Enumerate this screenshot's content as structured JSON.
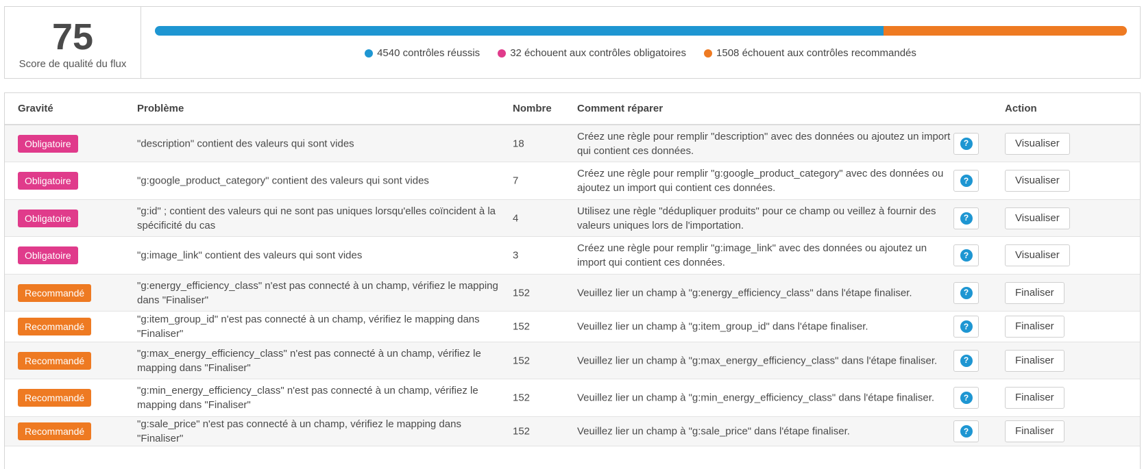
{
  "score": {
    "value": "75",
    "label": "Score de qualité du flux",
    "passed": 4540,
    "failed_mandatory": 32,
    "failed_recommended": 1508,
    "legend": [
      {
        "text": "4540 contrôles réussis",
        "color": "#1e96d2"
      },
      {
        "text": "32 échouent aux contrôles obligatoires",
        "color": "#e03b8b"
      },
      {
        "text": "1508 échouent aux contrôles recommandés",
        "color": "#ee7a22"
      }
    ],
    "bar": [
      {
        "fraction": 0.7499,
        "color": "#1e96d2"
      },
      {
        "fraction": 0.2501,
        "color": "#ee7a22"
      }
    ]
  },
  "table": {
    "headers": {
      "severity": "Gravité",
      "problem": "Problème",
      "count": "Nombre",
      "fix": "Comment réparer",
      "action": "Action"
    },
    "rows": [
      {
        "severity": "Obligatoire",
        "type": "mand",
        "problem": "\"description\" contient des valeurs qui sont vides",
        "count": "18",
        "fix": "Créez une règle pour remplir \"description\" avec des données ou ajoutez un import qui contient ces données.",
        "action": "Visualiser"
      },
      {
        "severity": "Obligatoire",
        "type": "mand",
        "problem": "\"g:google_product_category\" contient des valeurs qui sont vides",
        "count": "7",
        "fix": "Créez une règle pour remplir \"g:google_product_category\" avec des données ou ajoutez un import qui contient ces données.",
        "action": "Visualiser"
      },
      {
        "severity": "Obligatoire",
        "type": "mand",
        "problem": "\"g:id\" ; contient des valeurs qui ne sont pas uniques lorsqu'elles coïncident à la spécificité du cas",
        "count": "4",
        "fix": "Utilisez une règle \"dédupliquer produits\" pour ce champ ou veillez à fournir des valeurs uniques lors de l'importation.",
        "action": "Visualiser"
      },
      {
        "severity": "Obligatoire",
        "type": "mand",
        "problem": "\"g:image_link\" contient des valeurs qui sont vides",
        "count": "3",
        "fix": "Créez une règle pour remplir \"g:image_link\" avec des données ou ajoutez un import qui contient ces données.",
        "action": "Visualiser"
      },
      {
        "severity": "Recommandé",
        "type": "reco",
        "problem": "\"g:energy_efficiency_class\" n'est pas connecté à un champ, vérifiez le mapping dans \"Finaliser\"",
        "count": "152",
        "fix": "Veuillez lier un champ à \"g:energy_efficiency_class\" dans l'étape finaliser.",
        "action": "Finaliser"
      },
      {
        "severity": "Recommandé",
        "type": "reco",
        "problem": "\"g:item_group_id\" n'est pas connecté à un champ, vérifiez le mapping dans \"Finaliser\"",
        "count": "152",
        "fix": "Veuillez lier un champ à \"g:item_group_id\" dans l'étape finaliser.",
        "action": "Finaliser"
      },
      {
        "severity": "Recommandé",
        "type": "reco",
        "problem": "\"g:max_energy_efficiency_class\" n'est pas connecté à un champ, vérifiez le mapping dans \"Finaliser\"",
        "count": "152",
        "fix": "Veuillez lier un champ à \"g:max_energy_efficiency_class\" dans l'étape finaliser.",
        "action": "Finaliser"
      },
      {
        "severity": "Recommandé",
        "type": "reco",
        "problem": "\"g:min_energy_efficiency_class\" n'est pas connecté à un champ, vérifiez le mapping dans \"Finaliser\"",
        "count": "152",
        "fix": "Veuillez lier un champ à \"g:min_energy_efficiency_class\" dans l'étape finaliser.",
        "action": "Finaliser"
      },
      {
        "severity": "Recommandé",
        "type": "reco",
        "problem": "\"g:sale_price\" n'est pas connecté à un champ, vérifiez le mapping dans \"Finaliser\"",
        "count": "152",
        "fix": "Veuillez lier un champ à \"g:sale_price\" dans l'étape finaliser.",
        "action": "Finaliser"
      }
    ],
    "help_icon": "question-circle-icon"
  }
}
